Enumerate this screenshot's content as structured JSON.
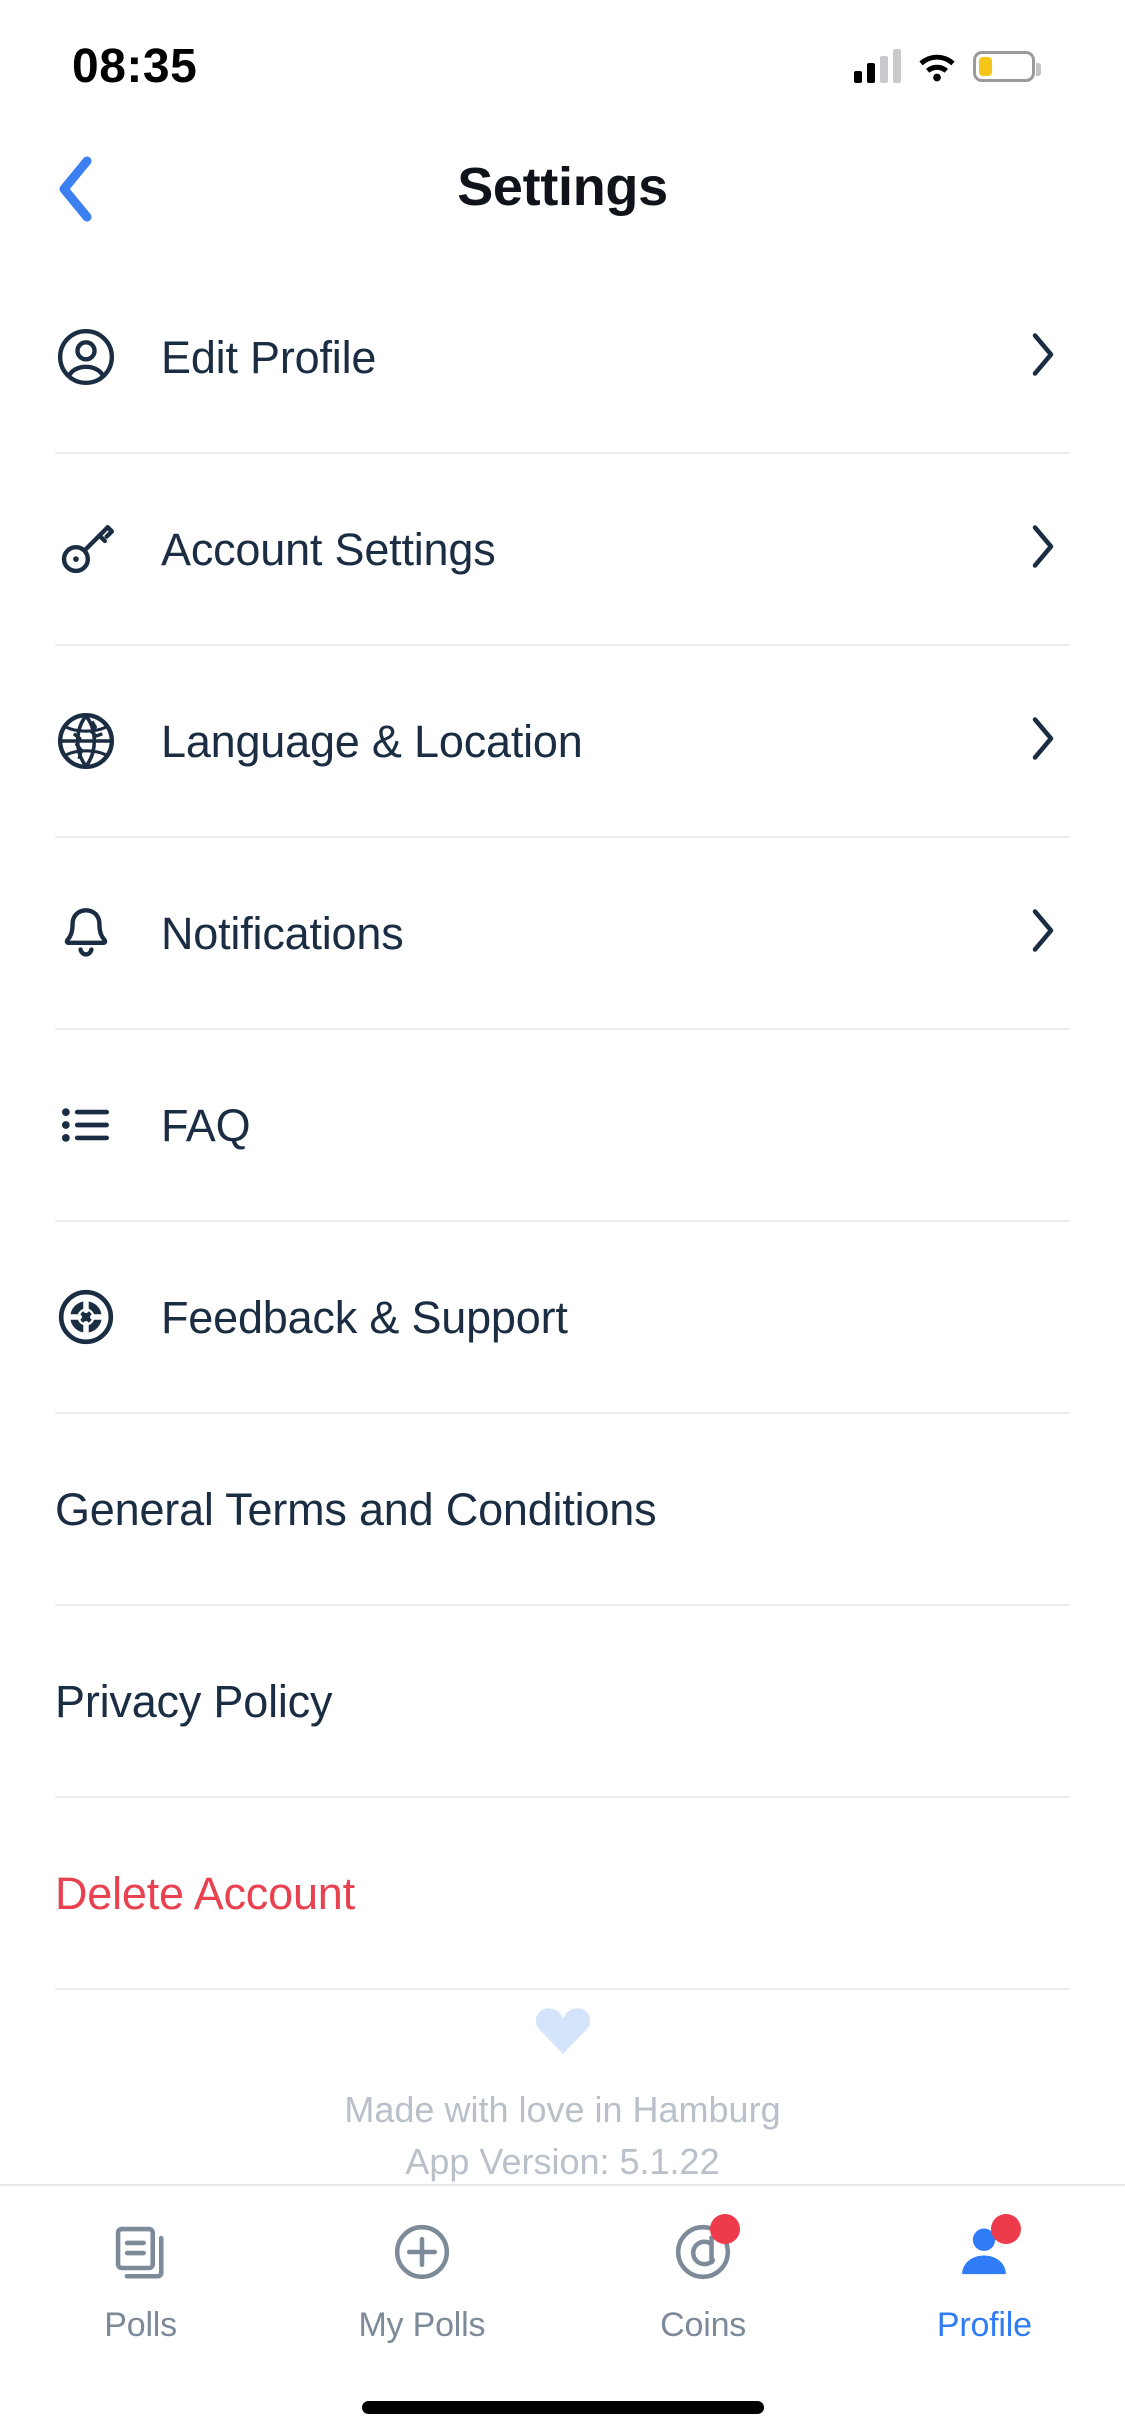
{
  "status_bar": {
    "time": "08:35",
    "cellular_icon": "signal-bars-icon",
    "wifi_icon": "wifi-icon",
    "battery_icon": "battery-low-icon",
    "battery_color": "#f5c518",
    "signal_bars_active": 2,
    "signal_bars_total": 4
  },
  "header": {
    "back_icon": "chevron-left-icon",
    "back_color": "#3c7ff0",
    "title": "Settings"
  },
  "settings_list": [
    {
      "id": "edit-profile",
      "label": "Edit Profile",
      "icon": "user-circle-icon",
      "has_chevron": true,
      "danger": false
    },
    {
      "id": "account-settings",
      "label": "Account Settings",
      "icon": "key-icon",
      "has_chevron": true,
      "danger": false
    },
    {
      "id": "language-location",
      "label": "Language & Location",
      "icon": "globe-icon",
      "has_chevron": true,
      "danger": false
    },
    {
      "id": "notifications",
      "label": "Notifications",
      "icon": "bell-icon",
      "has_chevron": true,
      "danger": false
    },
    {
      "id": "faq",
      "label": "FAQ",
      "icon": "bullet-list-icon",
      "has_chevron": false,
      "danger": false
    },
    {
      "id": "feedback-support",
      "label": "Feedback & Support",
      "icon": "lifebuoy-icon",
      "has_chevron": false,
      "danger": false
    },
    {
      "id": "terms",
      "label": "General Terms and Conditions",
      "icon": null,
      "has_chevron": false,
      "danger": false
    },
    {
      "id": "privacy-policy",
      "label": "Privacy Policy",
      "icon": null,
      "has_chevron": false,
      "danger": false
    },
    {
      "id": "delete-account",
      "label": "Delete Account",
      "icon": null,
      "has_chevron": false,
      "danger": true
    }
  ],
  "colors": {
    "label": "#1b2d42",
    "danger": "#e8414f",
    "divider": "#ececee",
    "accent": "#2f7cf6",
    "muted": "#b9c0ca",
    "badge": "#ee3b4c"
  },
  "footer": {
    "heart_icon": "heart-icon",
    "heart_color": "#d4e4fb",
    "made_with_love": "Made with love in Hamburg",
    "app_version": "App Version: 5.1.22"
  },
  "tab_bar": [
    {
      "id": "polls",
      "label": "Polls",
      "icon": "documents-stack-icon",
      "active": false,
      "badge": false
    },
    {
      "id": "my-polls",
      "label": "My Polls",
      "icon": "plus-circle-icon",
      "active": false,
      "badge": false
    },
    {
      "id": "coins",
      "label": "Coins",
      "icon": "coin-icon",
      "active": false,
      "badge": true
    },
    {
      "id": "profile",
      "label": "Profile",
      "icon": "person-filled-icon",
      "active": true,
      "badge": true
    }
  ]
}
